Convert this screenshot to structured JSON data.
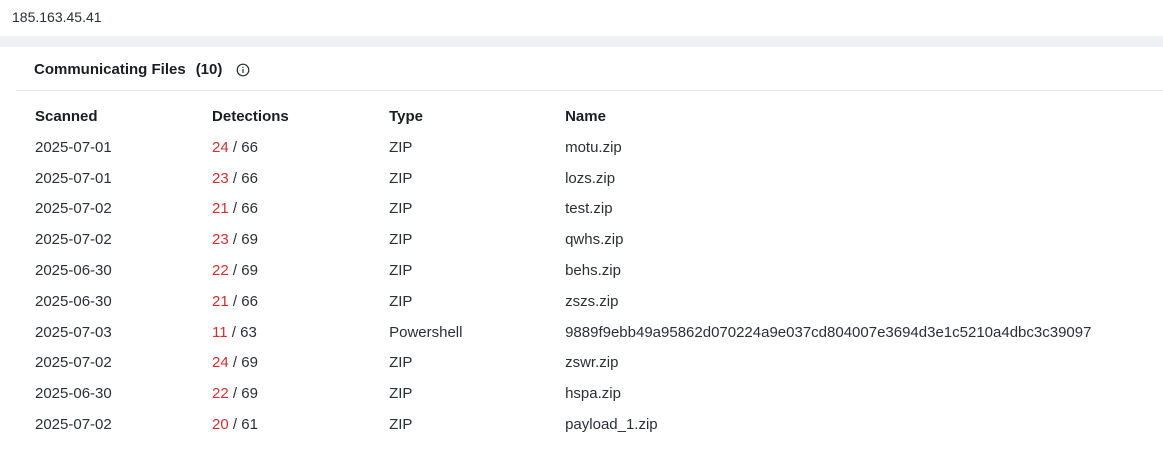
{
  "address_bar": {
    "ip": "185.163.45.41"
  },
  "section": {
    "title": "Communicating Files",
    "count": "(10)",
    "info_icon": "info-circle-icon"
  },
  "table": {
    "headers": {
      "scanned": "Scanned",
      "detections": "Detections",
      "type": "Type",
      "name": "Name"
    },
    "rows": [
      {
        "scanned": "2025-07-01",
        "detected": "24",
        "total": "/ 66",
        "type": "ZIP",
        "name": "motu.zip"
      },
      {
        "scanned": "2025-07-01",
        "detected": "23",
        "total": "/ 66",
        "type": "ZIP",
        "name": "lozs.zip"
      },
      {
        "scanned": "2025-07-02",
        "detected": "21",
        "total": "/ 66",
        "type": "ZIP",
        "name": "test.zip"
      },
      {
        "scanned": "2025-07-02",
        "detected": "23",
        "total": "/ 69",
        "type": "ZIP",
        "name": "qwhs.zip"
      },
      {
        "scanned": "2025-06-30",
        "detected": "22",
        "total": "/ 69",
        "type": "ZIP",
        "name": "behs.zip"
      },
      {
        "scanned": "2025-06-30",
        "detected": "21",
        "total": "/ 66",
        "type": "ZIP",
        "name": "zszs.zip"
      },
      {
        "scanned": "2025-07-03",
        "detected": "11",
        "total": "/ 63",
        "type": "Powershell",
        "name": "9889f9ebb49a95862d070224a9e037cd804007e3694d3e1c5210a4dbc3c39097"
      },
      {
        "scanned": "2025-07-02",
        "detected": "24",
        "total": "/ 69",
        "type": "ZIP",
        "name": "zswr.zip"
      },
      {
        "scanned": "2025-06-30",
        "detected": "22",
        "total": "/ 69",
        "type": "ZIP",
        "name": "hspa.zip"
      },
      {
        "scanned": "2025-07-02",
        "detected": "20",
        "total": "/ 61",
        "type": "ZIP",
        "name": "payload_1.zip"
      }
    ]
  },
  "colors": {
    "detection_positive": "#d32f2f",
    "band": "#eef0f4"
  }
}
